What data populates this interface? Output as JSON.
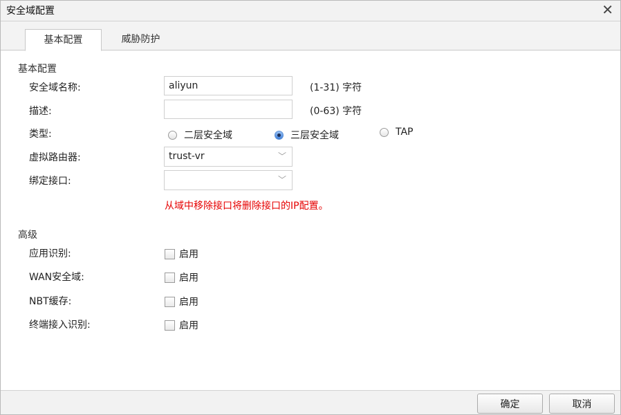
{
  "dialog": {
    "title": "安全域配置",
    "close_icon": "✕"
  },
  "tabs": [
    {
      "label": "基本配置",
      "active": true
    },
    {
      "label": "威胁防护",
      "active": false
    }
  ],
  "basic": {
    "section_title": "基本配置",
    "name_label": "安全域名称:",
    "name_value": "aliyun",
    "name_hint": "(1-31) 字符",
    "desc_label": "描述:",
    "desc_value": "",
    "desc_hint": "(0-63) 字符",
    "type_label": "类型:",
    "type_options": [
      {
        "label": "二层安全域",
        "checked": false
      },
      {
        "label": "三层安全域",
        "checked": true
      },
      {
        "label": "TAP",
        "checked": false
      }
    ],
    "vrouter_label": "虚拟路由器:",
    "vrouter_value": "trust-vr",
    "bind_label": "绑定接口:",
    "bind_value": "",
    "warning": "从域中移除接口将删除接口的IP配置。"
  },
  "advanced": {
    "section_title": "高级",
    "items": [
      {
        "label": "应用识别:",
        "option": "启用",
        "checked": false
      },
      {
        "label": "WAN安全域:",
        "option": "启用",
        "checked": false
      },
      {
        "label": "NBT缓存:",
        "option": "启用",
        "checked": false
      },
      {
        "label": "终端接入识别:",
        "option": "启用",
        "checked": false
      }
    ]
  },
  "footer": {
    "ok_label": "确定",
    "cancel_label": "取消"
  },
  "colors": {
    "warning": "#e60000",
    "radio_selected": "#3f7fd8"
  }
}
